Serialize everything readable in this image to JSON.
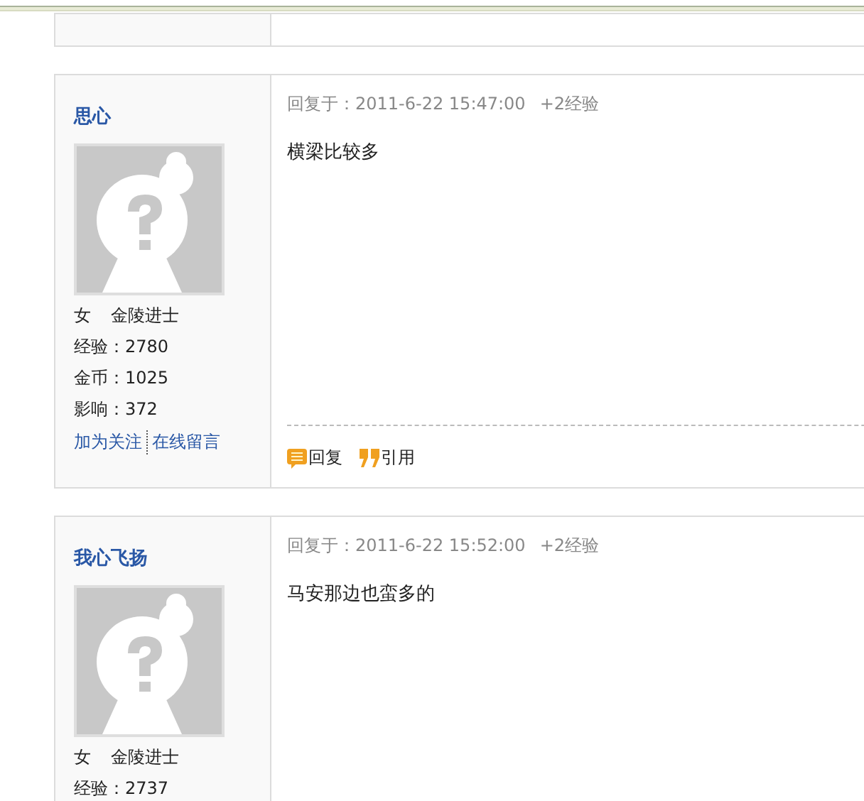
{
  "posts": [
    {
      "author": "思心",
      "gender": "女",
      "rank": "金陵进士",
      "stats": [
        "经验：2780",
        "金币：1025",
        "影响：372"
      ],
      "links": [
        "加为关注",
        "在线留言"
      ],
      "reply_label": "回复于：2011-6-22 15:47:00",
      "bonus": "+2经验",
      "body": "横梁比较多",
      "actions": [
        {
          "kind": "reply",
          "label": "回复"
        },
        {
          "kind": "quote",
          "label": "引用"
        }
      ]
    },
    {
      "author": "我心飞扬",
      "gender": "女",
      "rank": "金陵进士",
      "stats": [
        "经验：2737"
      ],
      "reply_label": "回复于：2011-6-22 15:52:00",
      "bonus": "+2经验",
      "body": "马安那边也蛮多的"
    }
  ]
}
